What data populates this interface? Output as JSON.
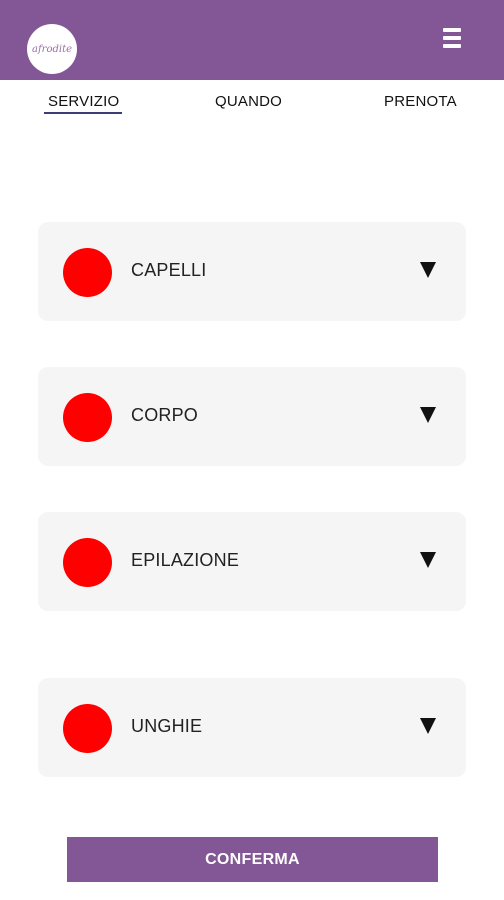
{
  "header": {
    "logo_text": "afrodite",
    "menu_icon": "hamburger-menu-icon",
    "colors": {
      "bar": "#835695"
    }
  },
  "tabs": [
    {
      "label": "SERVIZIO",
      "active": true
    },
    {
      "label": "QUANDO",
      "active": false
    },
    {
      "label": "PRENOTA",
      "active": false
    }
  ],
  "categories": [
    {
      "label": "CAPELLI",
      "dot_color": "#ff0000",
      "icon": "chevron-down-icon"
    },
    {
      "label": "CORPO",
      "dot_color": "#ff0000",
      "icon": "chevron-down-icon"
    },
    {
      "label": "EPILAZIONE",
      "dot_color": "#ff0000",
      "icon": "chevron-down-icon"
    },
    {
      "label": "UNGHIE",
      "dot_color": "#ff0000",
      "icon": "chevron-down-icon"
    }
  ],
  "actions": {
    "confirm_label": "CONFERMA",
    "accent": "#835695"
  }
}
